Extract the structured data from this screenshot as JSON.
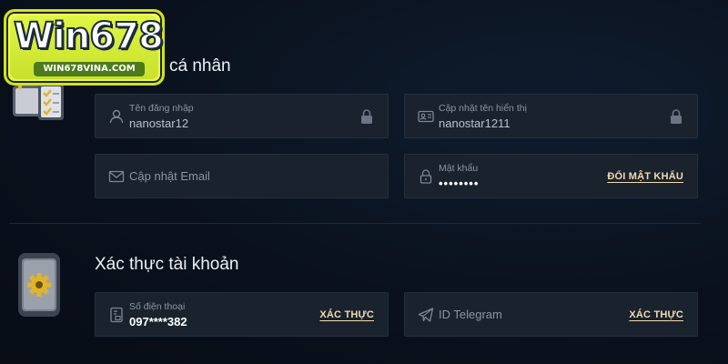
{
  "logo": {
    "word": "Win678",
    "url": "WIN678VINA.COM"
  },
  "personal": {
    "title": "cá nhân",
    "username": {
      "label": "Tên đăng nhập",
      "value": "nanostar12"
    },
    "display_name": {
      "label": "Cập nhật tên hiển thị",
      "value": "nanostar1211"
    },
    "email": {
      "placeholder": "Cập nhật Email"
    },
    "password": {
      "label": "Mật khẩu",
      "value": "••••••••",
      "action": "ĐỔI MẬT KHẨU"
    }
  },
  "verify": {
    "title": "Xác thực tài khoản",
    "phone": {
      "label": "Số điện thoại",
      "value": "097****382",
      "action": "XÁC THỰC"
    },
    "telegram": {
      "placeholder": "ID Telegram",
      "action": "XÁC THỰC"
    }
  },
  "colors": {
    "accent": "#f1dcae",
    "field_bg": "#1a222e",
    "logo_yellow": "#e7f73a"
  }
}
